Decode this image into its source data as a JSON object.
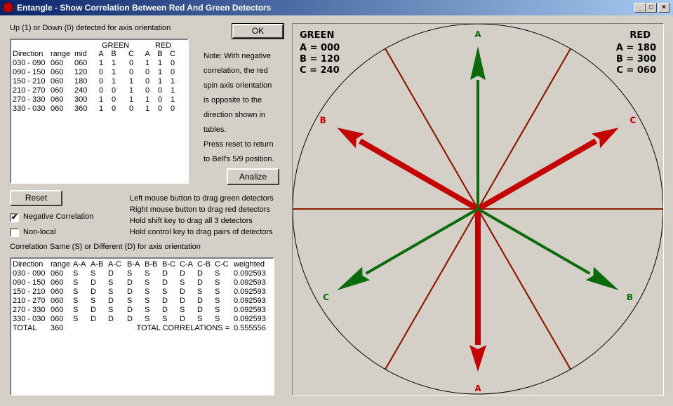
{
  "window": {
    "title": "Entangle - Show Correlation Between Red And Green Detectors"
  },
  "top_label": "Up (1) or Down (0) detected for axis orientation",
  "ok_label": "OK",
  "orientation_table": {
    "group_headers": {
      "green": "GREEN",
      "red": "RED"
    },
    "headers": [
      "Direction",
      "range",
      "mid",
      "A",
      "B",
      "C",
      "A",
      "B",
      "C"
    ],
    "rows": [
      [
        "030 - 090",
        "060",
        "060",
        "1",
        "1",
        "0",
        "1",
        "1",
        "0"
      ],
      [
        "090 - 150",
        "060",
        "120",
        "0",
        "1",
        "0",
        "0",
        "1",
        "0"
      ],
      [
        "150 - 210",
        "060",
        "180",
        "0",
        "1",
        "1",
        "0",
        "1",
        "1"
      ],
      [
        "210 - 270",
        "060",
        "240",
        "0",
        "0",
        "1",
        "0",
        "0",
        "1"
      ],
      [
        "270 - 330",
        "060",
        "300",
        "1",
        "0",
        "1",
        "1",
        "0",
        "1"
      ],
      [
        "330 - 030",
        "060",
        "360",
        "1",
        "0",
        "0",
        "1",
        "0",
        "0"
      ]
    ]
  },
  "note_lines": [
    "Note: With negative",
    "correlation, the red",
    "spin axis orientation",
    "is opposite to the",
    "direction shown in",
    "tables.",
    "Press reset to return",
    "to Bell's 5/9 position."
  ],
  "analize_label": "Analize",
  "reset_label": "Reset",
  "negative_correlation": {
    "label": "Negative Correlation",
    "checked": true,
    "mark": "✔"
  },
  "non_local": {
    "label": "Non-local",
    "checked": false
  },
  "instructions": [
    "Left mouse button to drag green detectors",
    "Right mouse button to drag red detectors",
    "Hold shift key to drag all 3 detectors",
    "Hold control key to drag pairs of detectors"
  ],
  "correlation_label": "Correlation Same (S) or Different (D) for axis orientation",
  "correlation_table": {
    "headers": [
      "Direction",
      "range",
      "A-A",
      "A-B",
      "A-C",
      "B-A",
      "B-B",
      "B-C",
      "C-A",
      "C-B",
      "C-C",
      "weighted"
    ],
    "rows": [
      [
        "030 - 090",
        "060",
        "S",
        "S",
        "D",
        "S",
        "S",
        "D",
        "D",
        "D",
        "S",
        "0.092593"
      ],
      [
        "090 - 150",
        "060",
        "S",
        "D",
        "S",
        "D",
        "S",
        "D",
        "S",
        "D",
        "S",
        "0.092593"
      ],
      [
        "150 - 210",
        "060",
        "S",
        "D",
        "S",
        "D",
        "S",
        "S",
        "D",
        "S",
        "S",
        "0.092593"
      ],
      [
        "210 - 270",
        "060",
        "S",
        "S",
        "D",
        "S",
        "S",
        "D",
        "D",
        "D",
        "S",
        "0.092593"
      ],
      [
        "270 - 330",
        "060",
        "S",
        "D",
        "S",
        "D",
        "S",
        "D",
        "S",
        "D",
        "S",
        "0.092593"
      ],
      [
        "330 - 030",
        "060",
        "S",
        "D",
        "D",
        "D",
        "S",
        "S",
        "D",
        "S",
        "S",
        "0.092593"
      ]
    ],
    "total_label": "TOTAL",
    "total_range": "360",
    "total_correlations_label": "TOTAL CORRELATIONS =",
    "total_correlations_value": "0.555556"
  },
  "diagram": {
    "green_title": "GREEN",
    "green_values": [
      "A = 000",
      "B = 120",
      "C = 240"
    ],
    "red_title": "RED",
    "red_values": [
      "A = 180",
      "B = 300",
      "C = 060"
    ],
    "green_angles_deg": [
      0,
      120,
      240
    ],
    "red_angles_deg": [
      180,
      300,
      60
    ],
    "green_arrow_labels": [
      "A",
      "B",
      "C"
    ],
    "red_arrow_labels": [
      "A",
      "B",
      "C"
    ],
    "divider_angles_deg": [
      30,
      90,
      150,
      210,
      270,
      330
    ],
    "colors": {
      "green": "#0b6b0b",
      "red": "#c40000",
      "divider": "#8b1a00",
      "bg": "#d4d0c8"
    }
  }
}
